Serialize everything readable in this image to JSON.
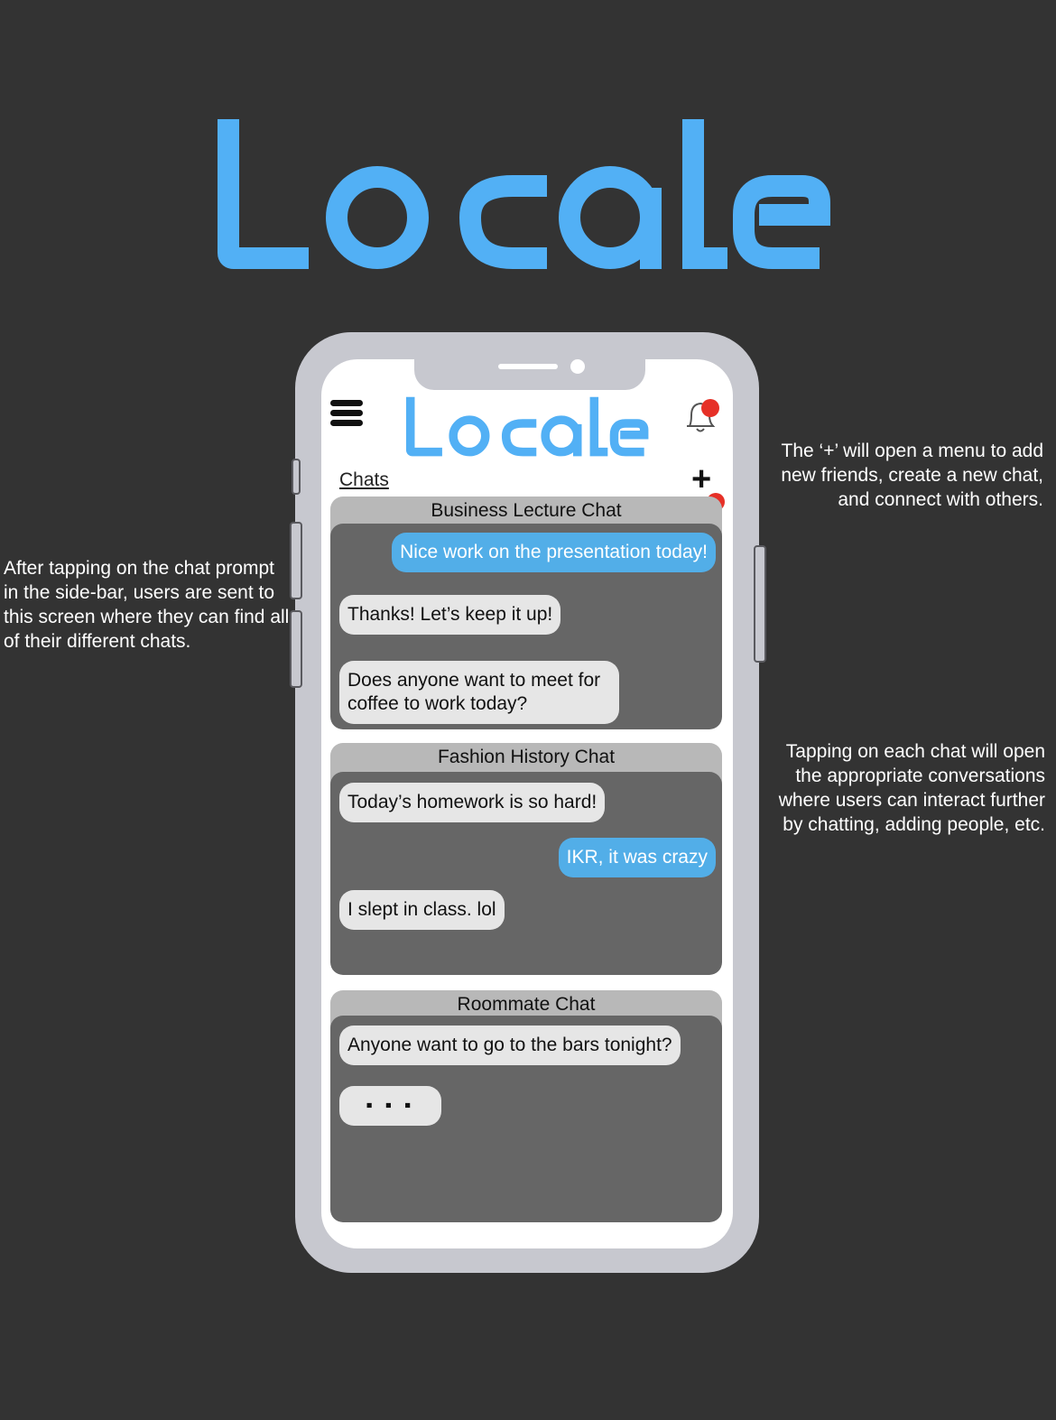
{
  "brand": {
    "logo_text": "Locale",
    "color": "#52b0f5"
  },
  "header": {
    "menu_icon": "hamburger-menu-icon",
    "bell_icon": "bell-icon",
    "add_icon": "plus",
    "notification_color": "#e63027"
  },
  "chats_label": "Chats",
  "add_symbol": "+",
  "chats": [
    {
      "title": "Business Lecture Chat",
      "messages": [
        {
          "text": "Nice work on the presentation today!",
          "side": "right"
        },
        {
          "text": "Thanks! Let’s keep it up!",
          "side": "left"
        },
        {
          "text": "Does anyone want to meet for coffee to work today?",
          "side": "left"
        }
      ]
    },
    {
      "title": "Fashion History Chat",
      "messages": [
        {
          "text": "Today’s homework is so hard!",
          "side": "left"
        },
        {
          "text": "IKR, it was crazy",
          "side": "right"
        },
        {
          "text": "I slept in class. lol",
          "side": "left"
        }
      ]
    },
    {
      "title": "Roommate Chat",
      "messages": [
        {
          "text": "Anyone want to go to the bars tonight?",
          "side": "left"
        },
        {
          "text": "▪ ▪ ▪",
          "side": "left"
        }
      ]
    }
  ],
  "annotations": {
    "left": "After tapping on the chat prompt in the side-bar, users are sent to this screen where they can find all of their different chats.",
    "right_top": "The ‘+’ will open a menu to add new friends, create a new chat, and connect with others.",
    "right_bottom": "Tapping on each chat will open the appropriate conversations where users can interact further by chatting, adding people, etc."
  }
}
